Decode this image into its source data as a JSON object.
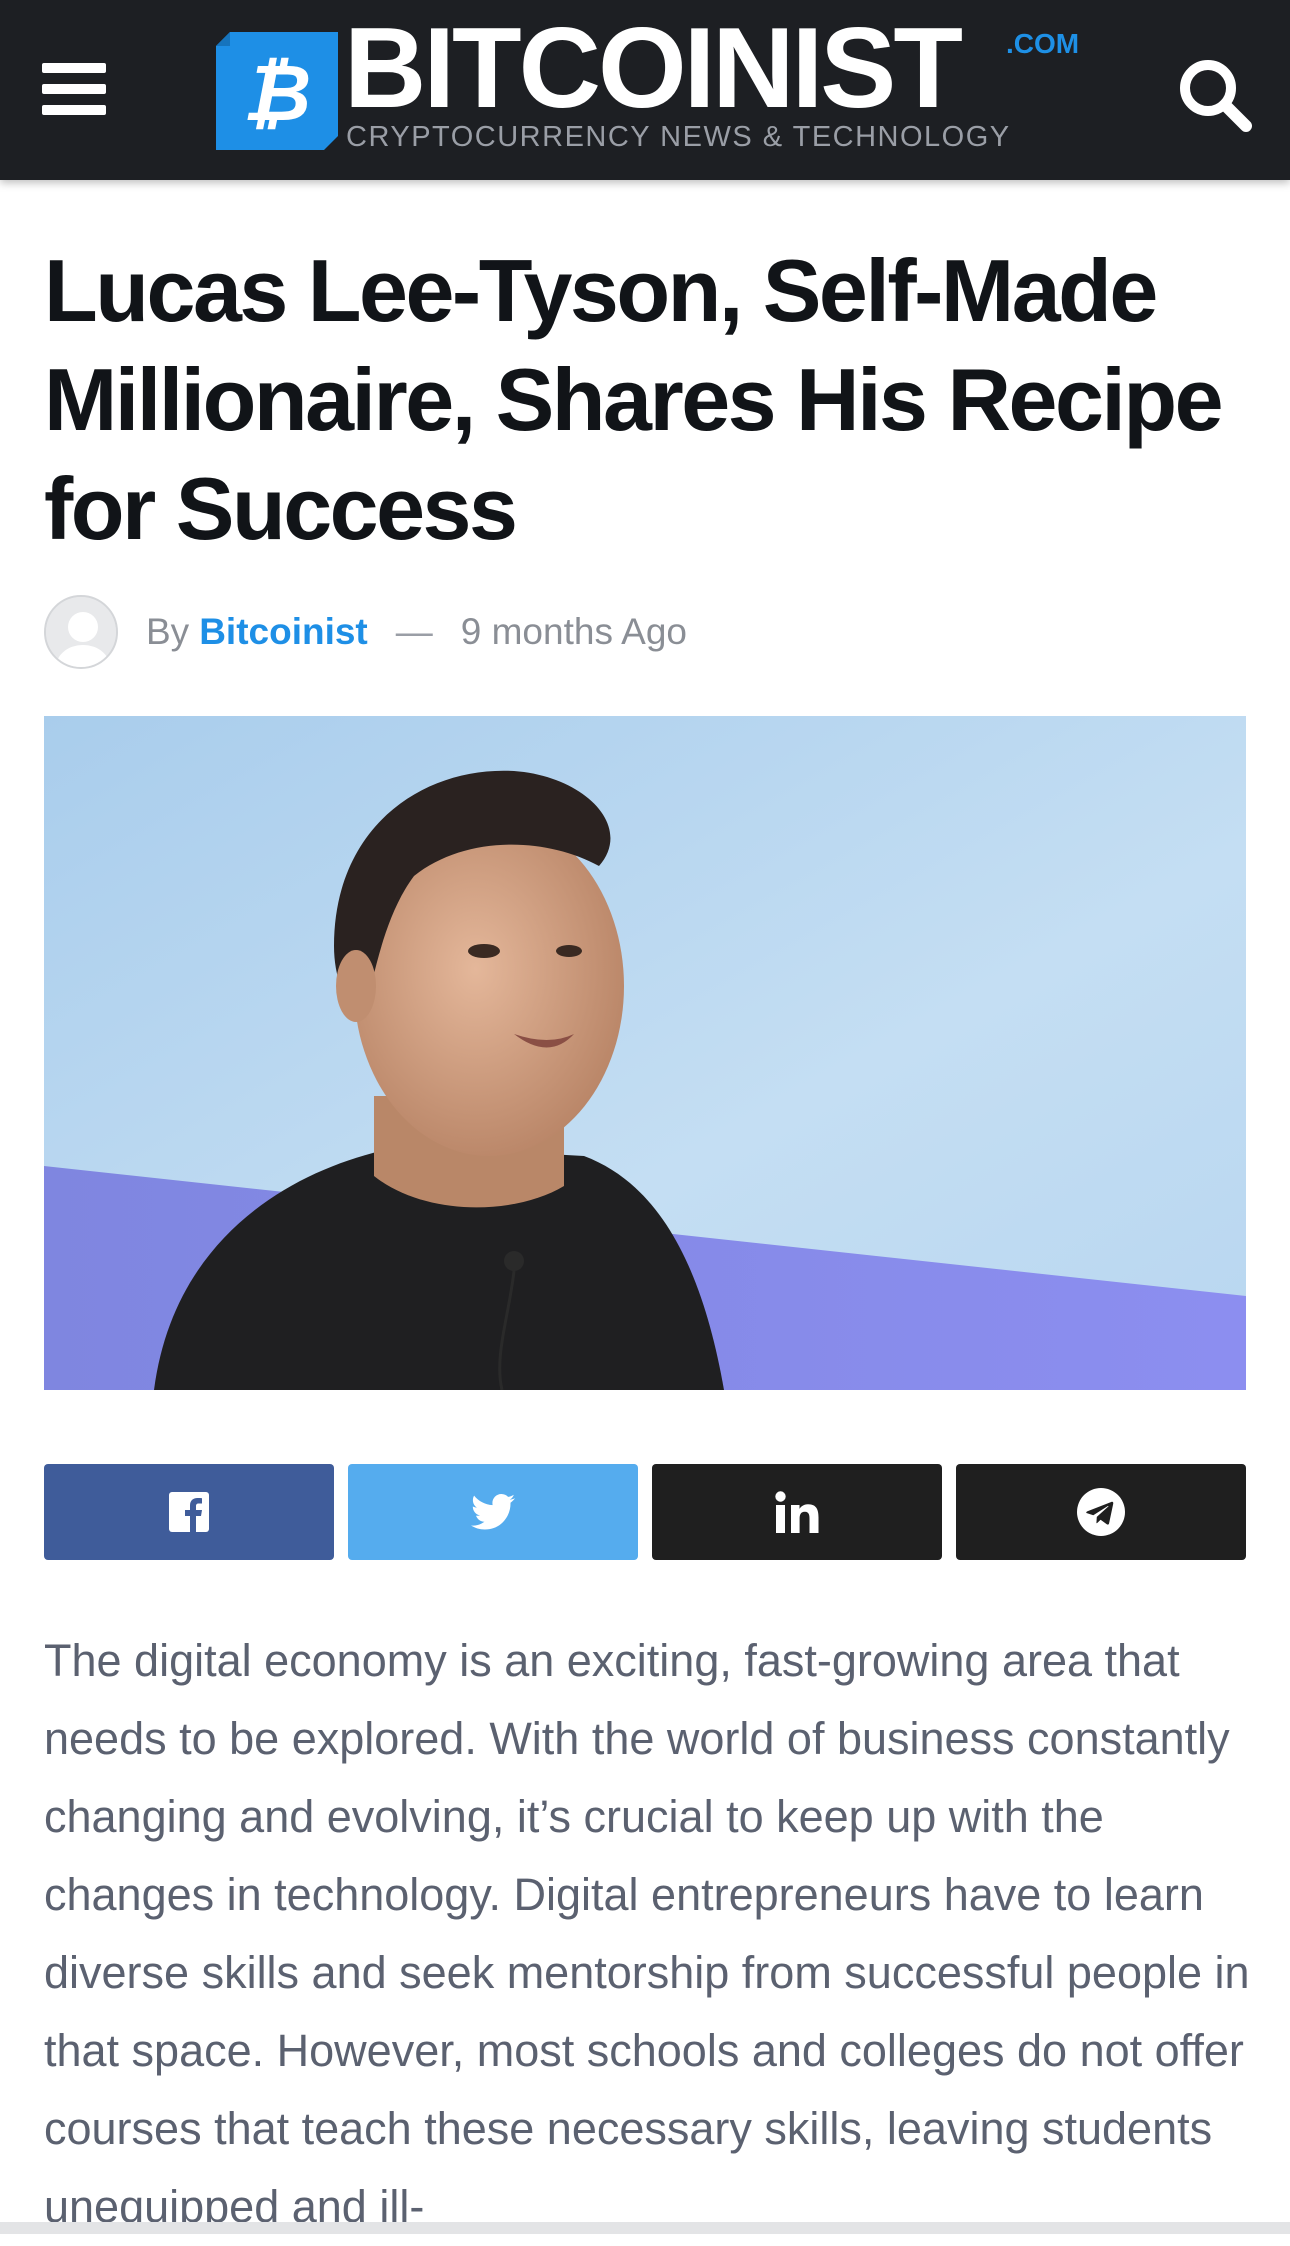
{
  "header": {
    "menu_icon": "hamburger-menu-icon",
    "logo": {
      "wordmark": "BITCOINIST",
      "tld": ".COM",
      "tagline": "CRYPTOCURRENCY NEWS & TECHNOLOGY",
      "mark_symbol": "₿",
      "mark_color": "#1e8fe6"
    },
    "search_icon": "search-icon",
    "background": "#1d1f23"
  },
  "article": {
    "headline": "Lucas Lee-Tyson, Self-Made Millionaire, Shares His Recipe for Success",
    "meta": {
      "by_label": "By",
      "author": "Bitcoinist",
      "separator": "—",
      "published": "9 months Ago"
    },
    "hero_image": "portrait-of-speaker-on-stage",
    "share_buttons": [
      {
        "network": "facebook",
        "icon": "facebook-icon",
        "color": "#3f5c9a"
      },
      {
        "network": "twitter",
        "icon": "twitter-icon",
        "color": "#55acee"
      },
      {
        "network": "linkedin",
        "icon": "linkedin-icon",
        "color": "#1f1f1f"
      },
      {
        "network": "telegram",
        "icon": "telegram-icon",
        "color": "#1f1f1f"
      }
    ],
    "body": "The digital economy is an exciting, fast-growing area that needs to be explored. With the world of business constantly changing and evolving, it’s crucial to keep up with the changes in technology. Digital entrepreneurs have to learn diverse skills and seek mentorship from successful people in that space. However, most schools and colleges do not offer courses that teach these necessary skills, leaving students unequipped and ill-"
  },
  "colors": {
    "accent": "#1e8fe6",
    "headline": "#111418",
    "body_text": "#5b6170",
    "meta_text": "#8a8e95"
  }
}
